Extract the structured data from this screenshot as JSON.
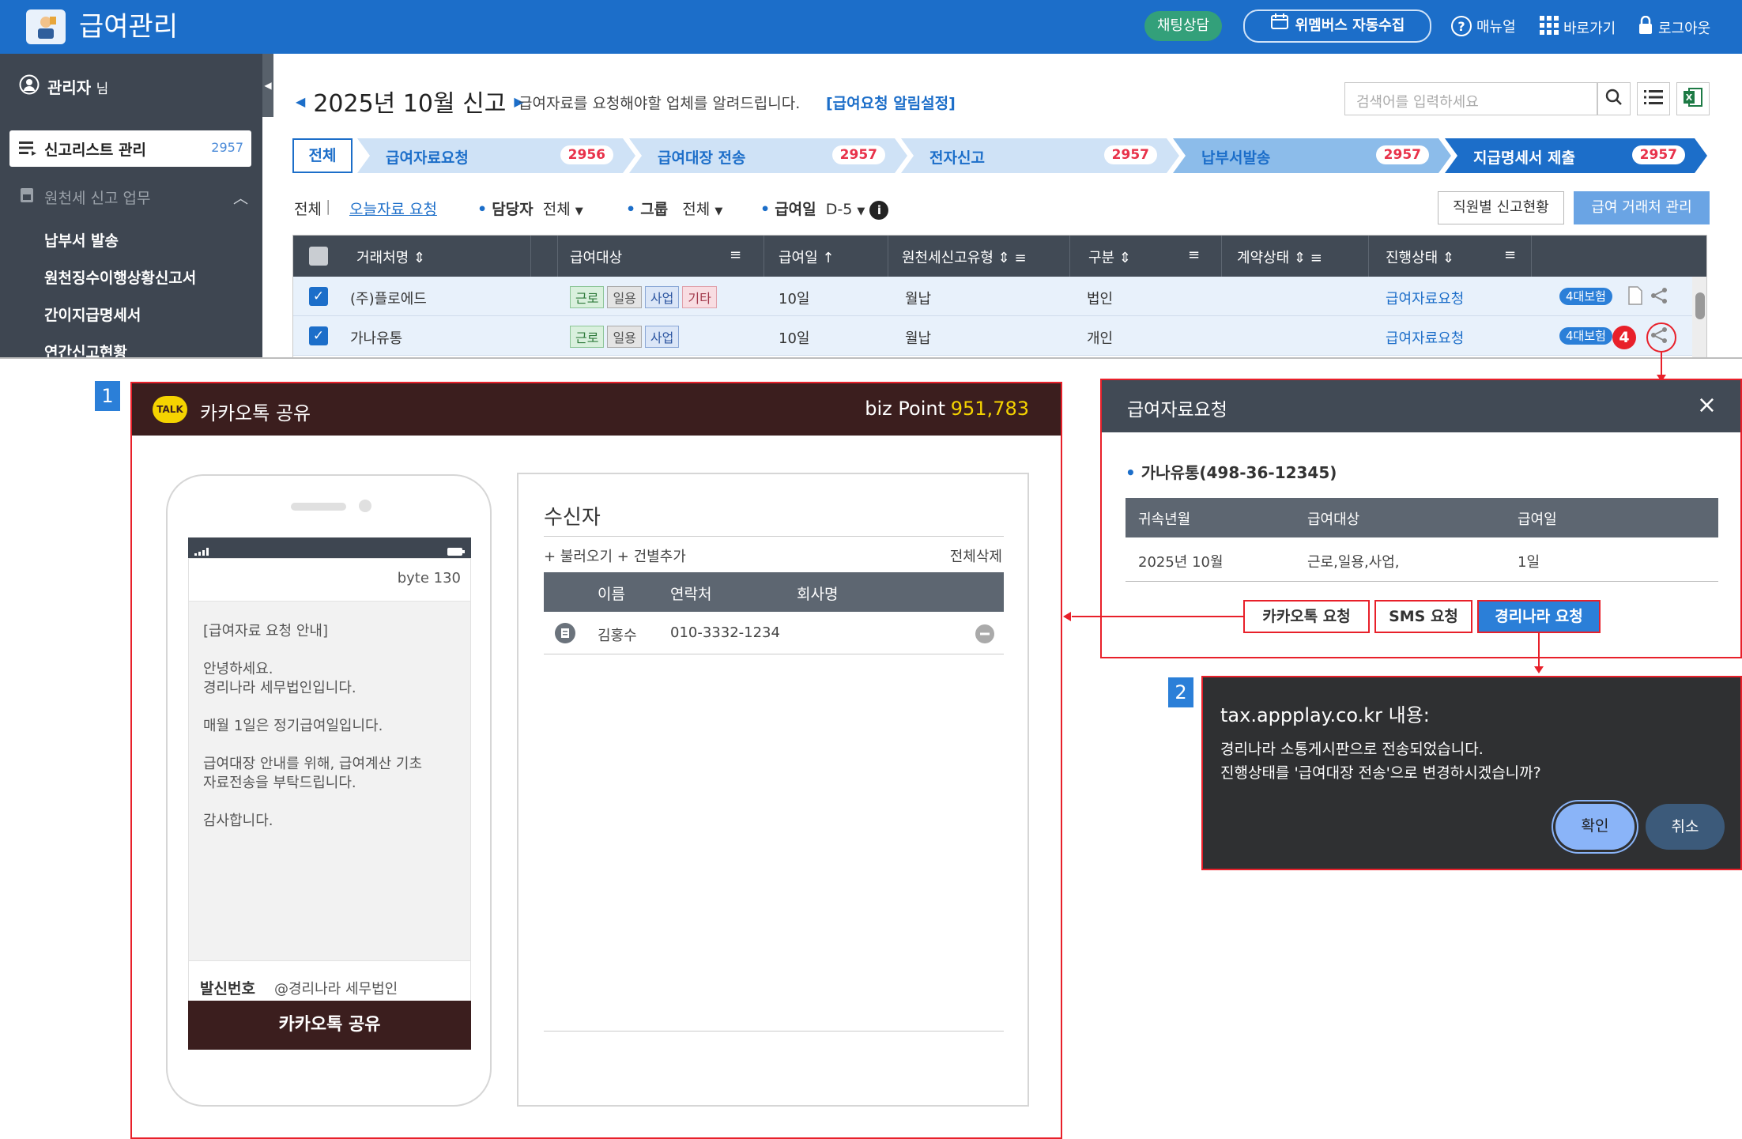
{
  "app": {
    "title": "급여관리",
    "chat_button": "채팅상담",
    "wm_button": "위멤버스 자동수집",
    "manual": "매뉴얼",
    "shortcut": "바로가기",
    "logout": "로그아웃"
  },
  "sidebar": {
    "user": "관리자",
    "user_suffix": "님",
    "active_item": "신고리스트 관리",
    "active_count": "2957",
    "section": "원천세 신고 업무",
    "items": [
      "납부서 발송",
      "원천징수이행상황신고서",
      "간이지급명세서",
      "연간신고현황"
    ]
  },
  "header": {
    "period": "2025년 10월 신고",
    "desc": "급여자료를 요청해야할 업체를 알려드립니다.",
    "link": "[급여요청 알림설정]",
    "search_placeholder": "검색어를 입력하세요"
  },
  "steps": {
    "all": "전체",
    "items": [
      {
        "label": "급여자료요청",
        "count": "2956"
      },
      {
        "label": "급여대장 전송",
        "count": "2957"
      },
      {
        "label": "전자신고",
        "count": "2957"
      },
      {
        "label": "납부서발송",
        "count": "2957"
      },
      {
        "label": "지급명세서 제출",
        "count": "2957"
      }
    ]
  },
  "filters": {
    "all": "전체",
    "today": "오늘자료 요청",
    "manager_label": "담당자",
    "manager_value": "전체",
    "group_label": "그룹",
    "group_value": "전체",
    "payday_label": "급여일",
    "payday_value": "D-5",
    "employee_btn": "직원별 신고현황",
    "client_btn": "급여 거래처 관리"
  },
  "grid": {
    "headers": [
      "거래처명",
      "급여대상",
      "급여일",
      "원천세신고유형",
      "구분",
      "계약상태",
      "진행상태"
    ],
    "rows": [
      {
        "name": "(주)플로에드",
        "tags": [
          "근로",
          "일용",
          "사업",
          "기타"
        ],
        "payday": "10일",
        "type": "월납",
        "kind": "법인",
        "status": "급여자료요청",
        "badge": "4대보험"
      },
      {
        "name": "가나유통",
        "tags": [
          "근로",
          "일용",
          "사업"
        ],
        "payday": "10일",
        "type": "월납",
        "kind": "개인",
        "status": "급여자료요청",
        "badge": "4대보험"
      }
    ],
    "marker": "4"
  },
  "kakao": {
    "tag": "1",
    "logo": "TALK",
    "title": "카카오톡 공유",
    "biz_label": "biz Point",
    "biz_value": "951,783",
    "byte": "byte 130",
    "message": [
      "[급여자료 요청 안내]",
      "",
      "안녕하세요.",
      "경리나라 세무법인입니다.",
      "",
      "매월 1일은 정기급여일입니다.",
      "",
      "급여대장 안내를 위해, 급여계산 기초",
      "자료전송을 부탁드립니다.",
      "",
      "감사합니다."
    ],
    "sender_label": "발신번호",
    "sender_value": "@경리나라 세무법인",
    "share_button": "카카오톡 공유",
    "recv_title": "수신자",
    "recv_tools": "+ 불러오기 + 건별추가",
    "recv_clear": "전체삭제",
    "recv_headers": [
      "이름",
      "연락처",
      "회사명"
    ],
    "recv_row": {
      "name": "김홍수",
      "phone": "010-3332-1234"
    }
  },
  "request": {
    "title": "급여자료요청",
    "company": "가나유통(498-36-12345)",
    "headers": [
      "귀속년월",
      "급여대상",
      "급여일"
    ],
    "row": {
      "period": "2025년 10월",
      "target": "근로,일용,사업,",
      "payday": "1일"
    },
    "btn_kakao": "카카오톡 요청",
    "btn_sms": "SMS 요청",
    "btn_nara": "경리나라 요청"
  },
  "dialog": {
    "tag": "2",
    "title": "tax.appplay.co.kr 내용:",
    "line1": "경리나라 소통게시판으로 전송되었습니다.",
    "line2": "진행상태를 '급여대장 전송'으로 변경하시겠습니까?",
    "ok": "확인",
    "cancel": "취소"
  },
  "colors": {
    "primary": "#1c6ec9",
    "kakao_brown": "#3b1e1e",
    "kakao_yellow": "#f5d300",
    "highlight": "#e8202a"
  }
}
